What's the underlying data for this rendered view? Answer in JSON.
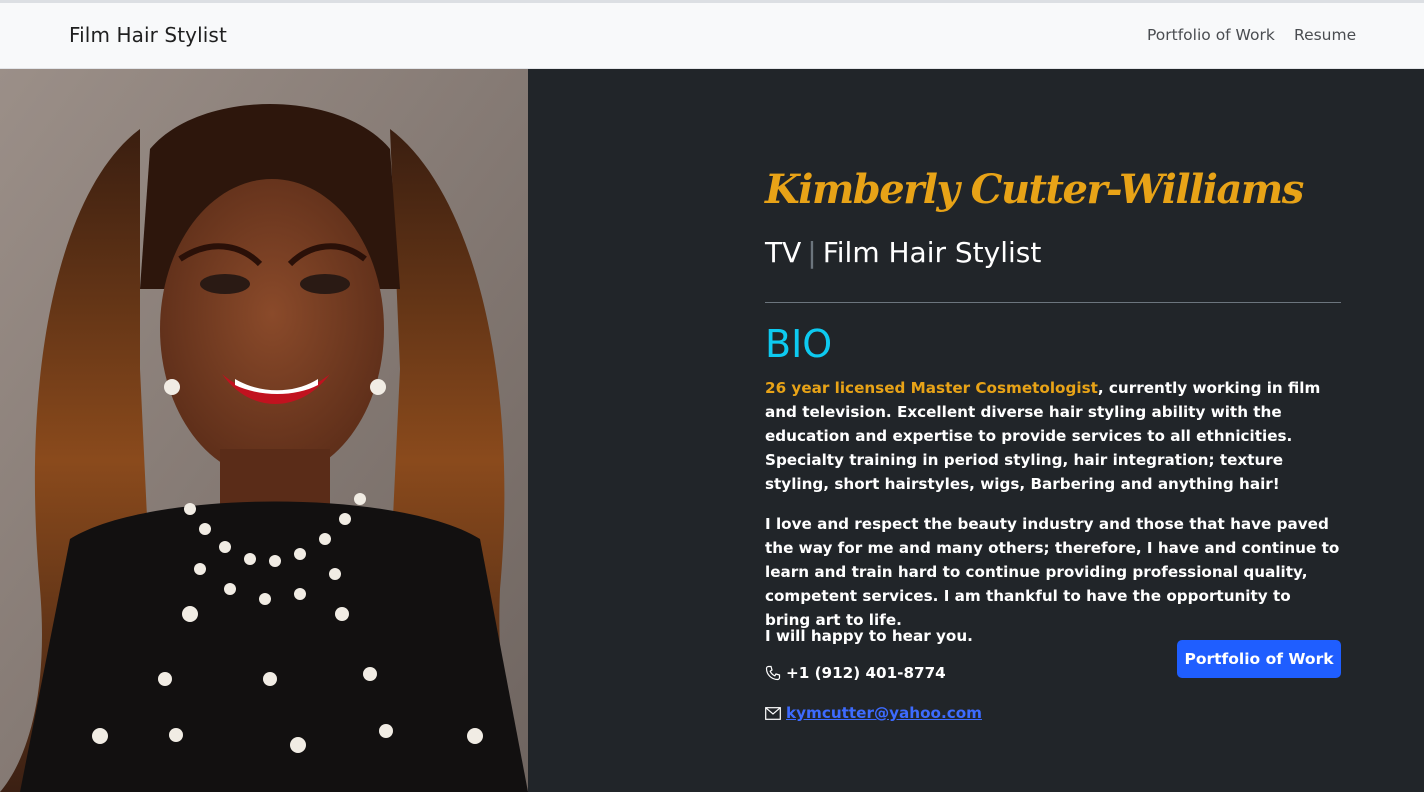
{
  "nav": {
    "brand": "Film Hair Stylist",
    "links": [
      "Portfolio of Work",
      "Resume"
    ]
  },
  "hero": {
    "name": "Kimberly Cutter-Williams",
    "subtitle_left": "TV",
    "subtitle_sep": "|",
    "subtitle_right": "Film Hair Stylist",
    "bio_heading": "BIO",
    "bio_highlight": "26 year licensed Master Cosmetologist",
    "bio_p1_rest": ", currently working in film and television. Excellent diverse hair styling ability with the education and expertise to provide services to all ethnicities. Specialty training in period styling, hair integration; texture styling, short hairstyles, wigs, Barbering and anything hair!",
    "bio_p2": "I love and respect the beauty industry and those that have paved the way for me and many others; therefore, I have and continue to learn and train hard to continue providing professional quality, competent services. I am thankful to have the opportunity to bring art to life.",
    "bio_p3": "I will happy to hear you.",
    "phone": "+1 (912) 401-8774",
    "email": "kymcutter@yahoo.com",
    "button_label": "Portfolio of Work"
  },
  "colors": {
    "accent_gold": "#e8a317",
    "accent_cyan": "#0dcaf0",
    "button_blue": "#1f5eff",
    "background_dark": "#212529"
  },
  "icons": [
    "phone-icon",
    "envelope-icon"
  ]
}
